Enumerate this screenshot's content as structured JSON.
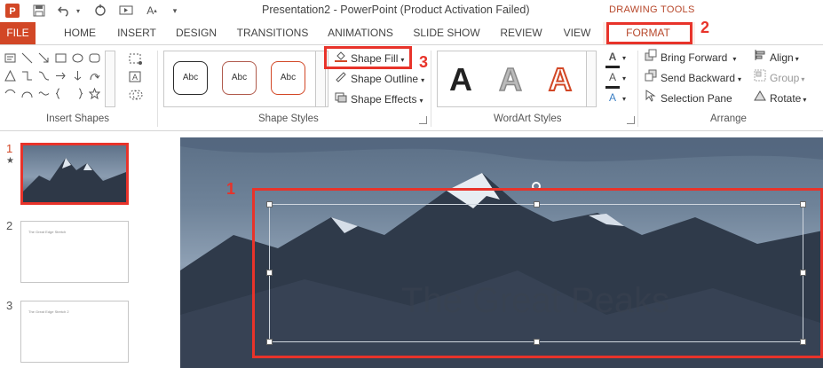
{
  "window": {
    "title": "Presentation2 - PowerPoint (Product Activation Failed)",
    "context_tab_group": "DRAWING TOOLS"
  },
  "tabs": [
    {
      "label": "FILE"
    },
    {
      "label": "HOME"
    },
    {
      "label": "INSERT"
    },
    {
      "label": "DESIGN"
    },
    {
      "label": "TRANSITIONS"
    },
    {
      "label": "ANIMATIONS"
    },
    {
      "label": "SLIDE SHOW"
    },
    {
      "label": "REVIEW"
    },
    {
      "label": "VIEW"
    },
    {
      "label": "FORMAT"
    }
  ],
  "ribbon": {
    "groups": {
      "insert_shapes": "Insert Shapes",
      "shape_styles": "Shape Styles",
      "wordart_styles": "WordArt Styles",
      "arrange": "Arrange"
    },
    "style_thumbs": [
      "Abc",
      "Abc",
      "Abc"
    ],
    "shape_commands": {
      "fill": "Shape Fill",
      "outline": "Shape Outline",
      "effects": "Shape Effects"
    },
    "wordart_letters": [
      "A",
      "A",
      "A"
    ],
    "arrange_commands": {
      "bring_forward": "Bring Forward",
      "send_backward": "Send Backward",
      "selection_pane": "Selection Pane",
      "align": "Align",
      "group": "Group",
      "rotate": "Rotate"
    }
  },
  "slides": [
    {
      "number": "1",
      "star": "★"
    },
    {
      "number": "2",
      "caption": "The Great Edge Stretch"
    },
    {
      "number": "3",
      "caption": "The Great Edge Stretch 2"
    }
  ],
  "slide": {
    "title_text": "The Great Peaks"
  },
  "annotations": {
    "one": "1",
    "two": "2",
    "three": "3"
  },
  "colors": {
    "accent": "#d24726",
    "callout": "#e8332a",
    "context": "#b7472a"
  }
}
